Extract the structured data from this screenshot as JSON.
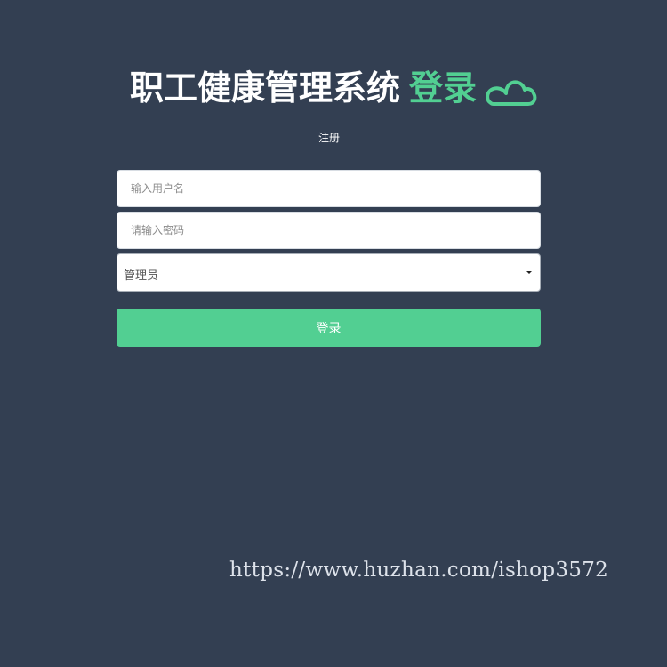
{
  "header": {
    "title": "职工健康管理系统",
    "title_accent": "登录",
    "logo_icon": "cloud-icon"
  },
  "register_link": "注册",
  "form": {
    "username_placeholder": "输入用户名",
    "password_placeholder": "请输入密码",
    "role_selected": "管理员",
    "role_icon": "caret-down-icon",
    "submit_label": "登录"
  },
  "watermark": "https://www.huzhan.com/ishop3572",
  "colors": {
    "background": "#333f52",
    "accent": "#52cf92",
    "field_background": "#ffffff"
  }
}
